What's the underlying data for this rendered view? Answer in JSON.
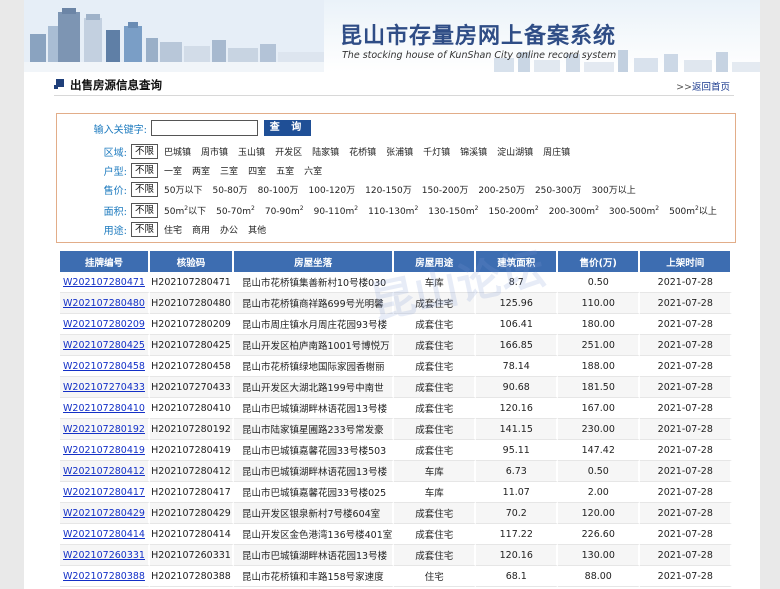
{
  "header": {
    "system_title": "昆山市存量房网上备案系统",
    "system_subtitle": "The stocking house of KunShan City online record system"
  },
  "section": {
    "title": "出售房源信息查询",
    "home_arrows": ">>",
    "home_link": "返回首页"
  },
  "filters": {
    "keyword_label": "输入关键字:",
    "keyword_value": "",
    "search_button": "查 询",
    "unlimited": "不限",
    "rows": [
      {
        "label": "区域:",
        "options": [
          "巴城镇",
          "周市镇",
          "玉山镇",
          "开发区",
          "陆家镇",
          "花桥镇",
          "张浦镇",
          "千灯镇",
          "锦溪镇",
          "淀山湖镇",
          "周庄镇"
        ]
      },
      {
        "label": "户型:",
        "options": [
          "一室",
          "两室",
          "三室",
          "四室",
          "五室",
          "六室"
        ]
      },
      {
        "label": "售价:",
        "options": [
          "50万以下",
          "50-80万",
          "80-100万",
          "100-120万",
          "120-150万",
          "150-200万",
          "200-250万",
          "250-300万",
          "300万以上"
        ]
      },
      {
        "label": "面积:",
        "options": [
          "50m²以下",
          "50-70m²",
          "70-90m²",
          "90-110m²",
          "110-130m²",
          "130-150m²",
          "150-200m²",
          "200-300m²",
          "300-500m²",
          "500m²以上"
        ]
      },
      {
        "label": "用途:",
        "options": [
          "住宅",
          "商用",
          "办公",
          "其他"
        ]
      }
    ]
  },
  "table": {
    "headers": [
      "挂牌编号",
      "核验码",
      "房屋坐落",
      "房屋用途",
      "建筑面积",
      "售价(万)",
      "上架时间"
    ],
    "rows": [
      [
        "W202107280471",
        "H202107280471",
        "昆山市花桥镇集善新村10号楼030",
        "车库",
        "8.7",
        "0.50",
        "2021-07-28"
      ],
      [
        "W202107280480",
        "H202107280480",
        "昆山市花桥镇商祥路699号光明馨",
        "成套住宅",
        "125.96",
        "110.00",
        "2021-07-28"
      ],
      [
        "W202107280209",
        "H202107280209",
        "昆山市周庄镇水月周庄花园93号楼",
        "成套住宅",
        "106.41",
        "180.00",
        "2021-07-28"
      ],
      [
        "W202107280425",
        "H202107280425",
        "昆山开发区柏庐南路1001号博悦万",
        "成套住宅",
        "166.85",
        "251.00",
        "2021-07-28"
      ],
      [
        "W202107280458",
        "H202107280458",
        "昆山市花桥镇绿地国际家园香榭丽",
        "成套住宅",
        "78.14",
        "188.00",
        "2021-07-28"
      ],
      [
        "W202107270433",
        "H202107270433",
        "昆山开发区大湖北路199号中南世",
        "成套住宅",
        "90.68",
        "181.50",
        "2021-07-28"
      ],
      [
        "W202107280410",
        "H202107280410",
        "昆山市巴城镇湖畔林语花园13号楼",
        "成套住宅",
        "120.16",
        "167.00",
        "2021-07-28"
      ],
      [
        "W202107280192",
        "H202107280192",
        "昆山市陆家镇星圃路233号常发豪",
        "成套住宅",
        "141.15",
        "230.00",
        "2021-07-28"
      ],
      [
        "W202107280419",
        "H202107280419",
        "昆山市巴城镇嘉馨花园33号楼503",
        "成套住宅",
        "95.11",
        "147.42",
        "2021-07-28"
      ],
      [
        "W202107280412",
        "H202107280412",
        "昆山市巴城镇湖畔林语花园13号楼",
        "车库",
        "6.73",
        "0.50",
        "2021-07-28"
      ],
      [
        "W202107280417",
        "H202107280417",
        "昆山市巴城镇嘉馨花园33号楼025",
        "车库",
        "11.07",
        "2.00",
        "2021-07-28"
      ],
      [
        "W202107280429",
        "H202107280429",
        "昆山开发区银泉新村7号楼604室",
        "成套住宅",
        "70.2",
        "120.00",
        "2021-07-28"
      ],
      [
        "W202107280414",
        "H202107280414",
        "昆山开发区金色港湾136号楼401室",
        "成套住宅",
        "117.22",
        "226.60",
        "2021-07-28"
      ],
      [
        "W202107260331",
        "H202107260331",
        "昆山市巴城镇湖畔林语花园13号楼",
        "成套住宅",
        "120.16",
        "130.00",
        "2021-07-28"
      ],
      [
        "W202107280388",
        "H202107280388",
        "昆山市花桥镇和丰路158号家速度",
        "住宅",
        "68.1",
        "88.00",
        "2021-07-28"
      ]
    ]
  },
  "watermark": "昆山论坛",
  "colors": {
    "accent": "#3d6db1",
    "title": "#2f4d86",
    "filter_label": "#1e7bbf",
    "link": "#1330c7",
    "filter_border": "#e2ad89"
  }
}
